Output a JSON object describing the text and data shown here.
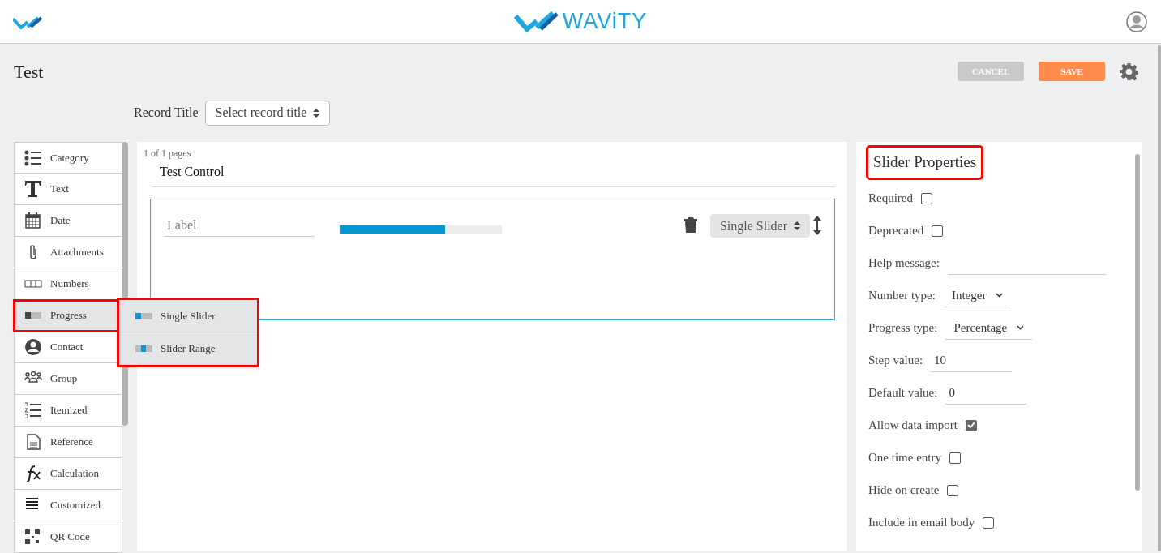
{
  "header": {
    "brand": "WAViTY"
  },
  "form": {
    "title": "Test",
    "buttons": [
      {
        "label": "CANCEL",
        "kind": "cancel"
      },
      {
        "label": "SAVE",
        "kind": "save"
      }
    ]
  },
  "record_title": {
    "label": "Record Title",
    "value": "Select record title"
  },
  "sidebar": {
    "items": [
      {
        "label": "Category",
        "selected": false,
        "highlighted": false
      },
      {
        "label": "Text",
        "selected": false,
        "highlighted": false
      },
      {
        "label": "Date",
        "selected": false,
        "highlighted": false
      },
      {
        "label": "Attachments",
        "selected": false,
        "highlighted": false
      },
      {
        "label": "Numbers",
        "selected": false,
        "highlighted": false
      },
      {
        "label": "Progress",
        "selected": true,
        "highlighted": true
      },
      {
        "label": "Contact",
        "selected": false,
        "highlighted": false
      },
      {
        "label": "Group",
        "selected": false,
        "highlighted": false
      },
      {
        "label": "Itemized",
        "selected": false,
        "highlighted": false
      },
      {
        "label": "Reference",
        "selected": false,
        "highlighted": false
      },
      {
        "label": "Calculation",
        "selected": false,
        "highlighted": false
      },
      {
        "label": "Customized",
        "selected": false,
        "highlighted": false
      },
      {
        "label": "QR Code",
        "selected": false,
        "highlighted": false
      }
    ]
  },
  "submenu": {
    "highlighted": true,
    "items": [
      {
        "label": "Single Slider",
        "kind": "single"
      },
      {
        "label": "Slider Range",
        "kind": "range"
      }
    ]
  },
  "canvas": {
    "page_count": "1 of 1 pages",
    "page_title": "Test Control",
    "field": {
      "placeholder": "Label",
      "level": 0.65,
      "slider_type": "Single Slider"
    }
  },
  "properties": {
    "title": "Slider Properties",
    "highlighted": true,
    "rows": [
      {
        "kind": "checkbox",
        "label": "Required",
        "checked": false
      },
      {
        "kind": "checkbox",
        "label": "Deprecated",
        "checked": false
      },
      {
        "kind": "text",
        "label": "Help message:",
        "value": ""
      },
      {
        "kind": "select",
        "label": "Number type:",
        "value": "Integer"
      },
      {
        "kind": "select",
        "label": "Progress type:",
        "value": "Percentage"
      },
      {
        "kind": "text",
        "label": "Step value:",
        "value": "10"
      },
      {
        "kind": "text",
        "label": "Default value:",
        "value": "0"
      },
      {
        "kind": "checkbox",
        "label": "Allow data import",
        "checked": true
      },
      {
        "kind": "checkbox",
        "label": "One time entry",
        "checked": false
      },
      {
        "kind": "checkbox",
        "label": "Hide on create",
        "checked": false
      },
      {
        "kind": "checkbox",
        "label": "Include in email body",
        "checked": false
      }
    ]
  }
}
